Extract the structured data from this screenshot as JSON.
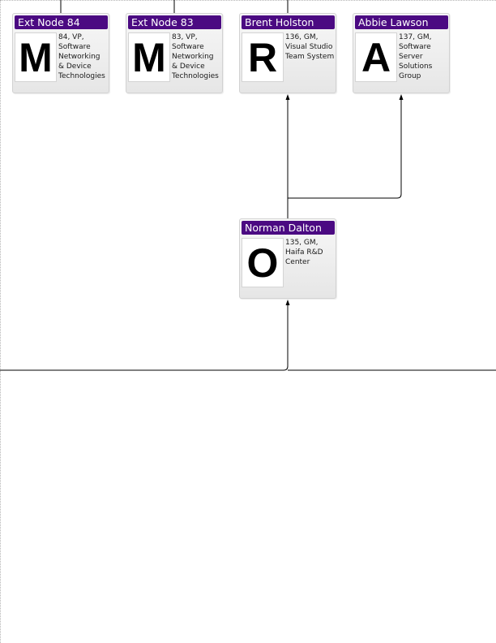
{
  "diagram": {
    "nodes": [
      {
        "id": "ext-node-84",
        "name": "Ext Node 84",
        "initial": "M",
        "info": "84, VP,\nSoftware\nNetworking\n& Device\nTechnologies"
      },
      {
        "id": "ext-node-83",
        "name": "Ext Node 83",
        "initial": "M",
        "info": "83, VP,\nSoftware\nNetworking\n& Device\nTechnologies"
      },
      {
        "id": "brent-holston",
        "name": "Brent Holston",
        "initial": "R",
        "info": "136, GM,\nVisual Studio\nTeam System"
      },
      {
        "id": "abbie-lawson",
        "name": "Abbie Lawson",
        "initial": "A",
        "info": "137, GM,\nSoftware\nServer\nSolutions\nGroup"
      },
      {
        "id": "norman-dalton",
        "name": "Norman Dalton",
        "initial": "O",
        "info": "135, GM,\nHaifa R&D\nCenter"
      }
    ],
    "connections": [
      {
        "from": "norman-dalton",
        "to": "brent-holston"
      },
      {
        "from": "norman-dalton",
        "to": "abbie-lawson"
      }
    ],
    "colors": {
      "title_bar": "#4b0a82",
      "title_text": "#ffffff",
      "connector": "#000000",
      "card_border": "#d2d2d2"
    }
  }
}
